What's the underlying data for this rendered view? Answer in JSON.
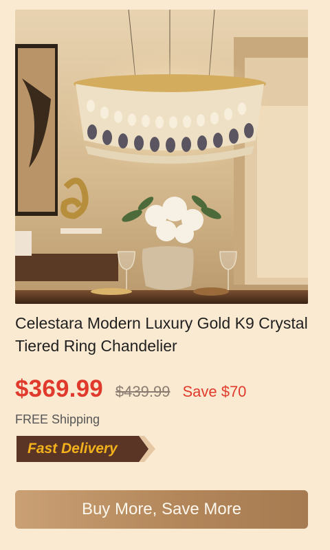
{
  "product": {
    "title": "Celestara Modern Luxury Gold K9 Crystal Tiered Ring Chandelier",
    "image_alt": "Crystal ring chandelier above a dining table"
  },
  "pricing": {
    "price": "$369.99",
    "original_price": "$439.99",
    "savings": "Save $70"
  },
  "shipping": "FREE Shipping",
  "badge": {
    "label": "Fast Delivery"
  },
  "actions": {
    "buy_label": "Buy More, Save More"
  },
  "colors": {
    "background": "#fbead2",
    "price": "#e03a2c",
    "badge_bg": "#5a3424",
    "badge_text": "#f3b21c",
    "button": "#b3875a"
  }
}
